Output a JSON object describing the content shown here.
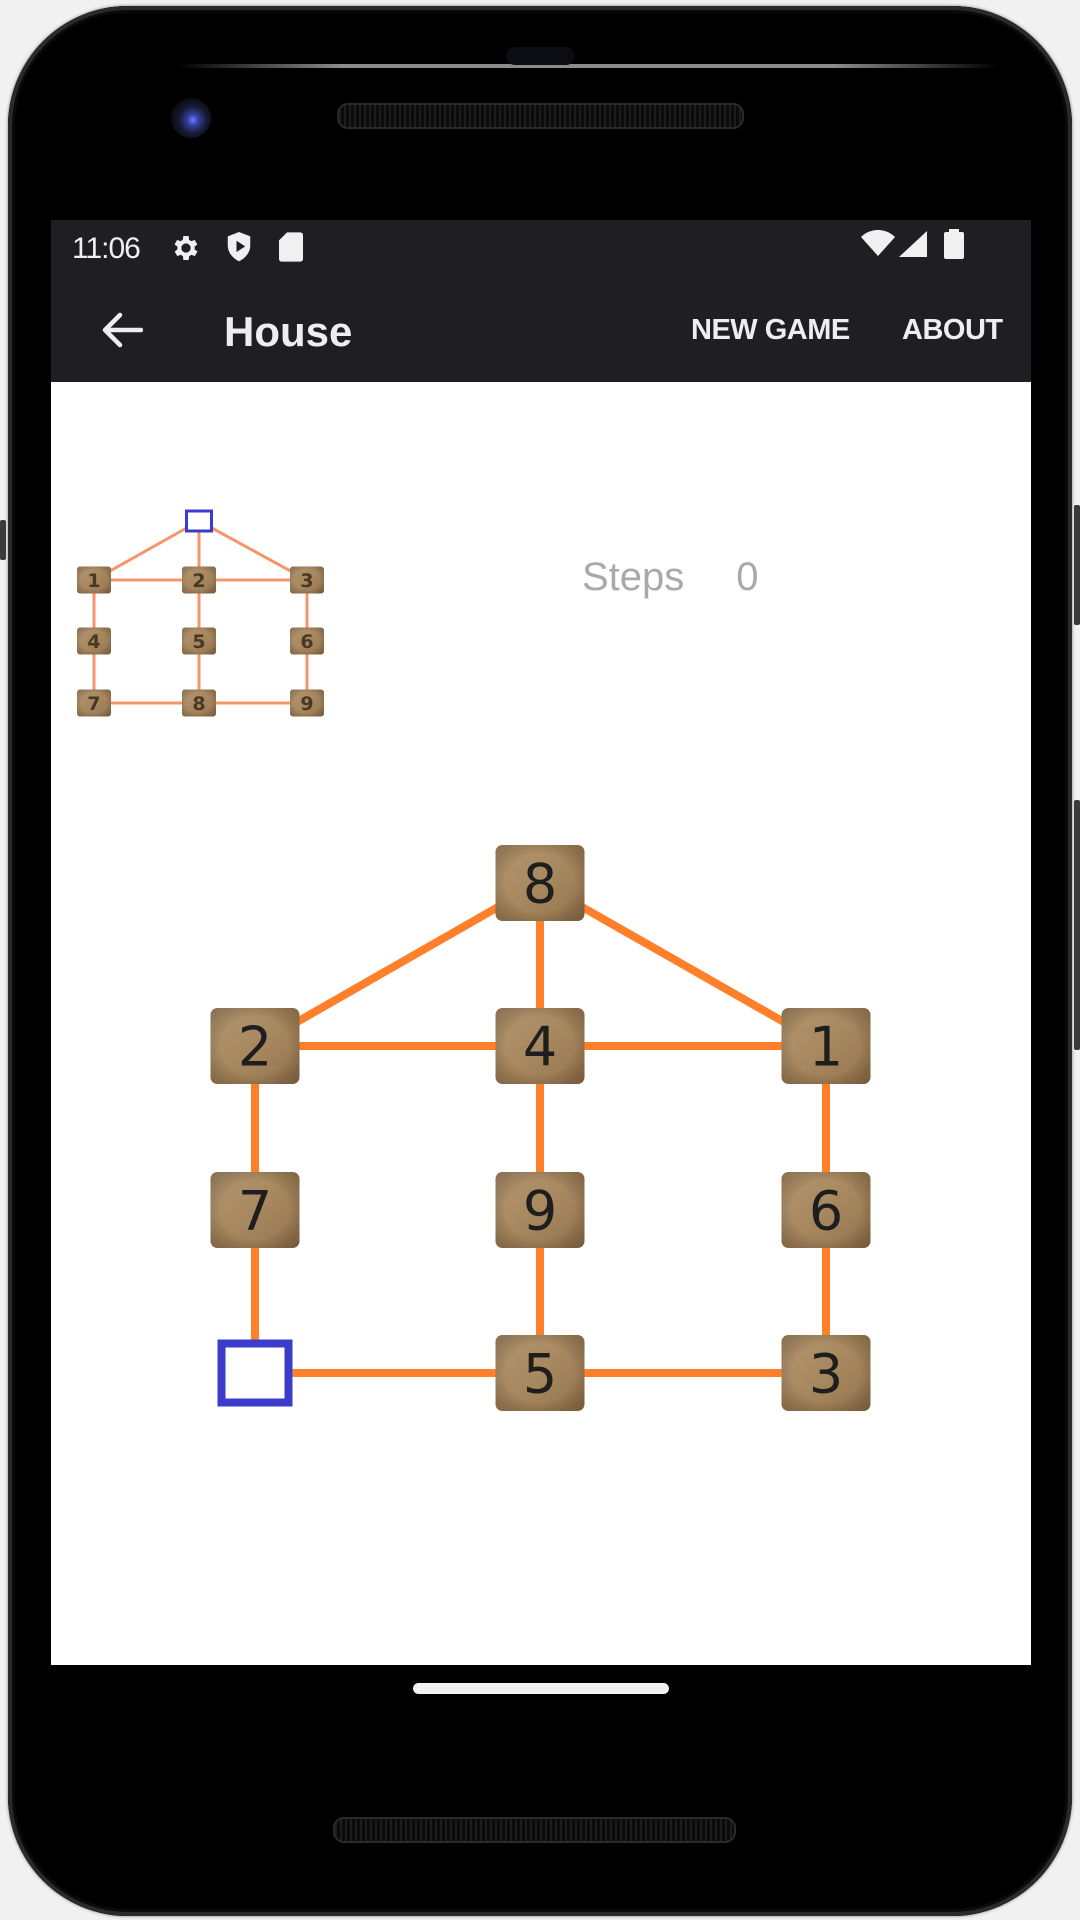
{
  "device": {
    "status_bar": {
      "time": "11:06",
      "left_icons": [
        "gear-icon",
        "shield-play-icon",
        "sd-card-icon"
      ],
      "right_icons": [
        "wifi-icon",
        "signal-icon",
        "battery-icon"
      ]
    }
  },
  "app_bar": {
    "back_icon": "arrow-left-icon",
    "title": "House",
    "actions": [
      {
        "label": "NEW GAME"
      },
      {
        "label": "ABOUT"
      }
    ]
  },
  "game": {
    "steps_label": "Steps",
    "steps_value": "0",
    "colors": {
      "edge": "#ff7f2a",
      "thumb_edge": "#f7956a",
      "empty_border": "#3c3ccc",
      "tile": "#a8885f",
      "tile_text": "#1e1e1e"
    },
    "nodes": [
      {
        "id": "top",
        "row": 0,
        "col": 1
      },
      {
        "id": "r1c0",
        "row": 1,
        "col": 0
      },
      {
        "id": "r1c1",
        "row": 1,
        "col": 1
      },
      {
        "id": "r1c2",
        "row": 1,
        "col": 2
      },
      {
        "id": "r2c0",
        "row": 2,
        "col": 0
      },
      {
        "id": "r2c1",
        "row": 2,
        "col": 1
      },
      {
        "id": "r2c2",
        "row": 2,
        "col": 2
      },
      {
        "id": "r3c0",
        "row": 3,
        "col": 0
      },
      {
        "id": "r3c1",
        "row": 3,
        "col": 1
      },
      {
        "id": "r3c2",
        "row": 3,
        "col": 2
      }
    ],
    "edges": [
      [
        "top",
        "r1c0"
      ],
      [
        "top",
        "r1c1"
      ],
      [
        "top",
        "r1c2"
      ],
      [
        "r1c0",
        "r1c1"
      ],
      [
        "r1c1",
        "r1c2"
      ],
      [
        "r1c0",
        "r2c0"
      ],
      [
        "r1c1",
        "r2c1"
      ],
      [
        "r1c2",
        "r2c2"
      ],
      [
        "r2c0",
        "r3c0"
      ],
      [
        "r2c1",
        "r3c1"
      ],
      [
        "r2c2",
        "r3c2"
      ],
      [
        "r3c0",
        "r3c1"
      ],
      [
        "r3c1",
        "r3c2"
      ]
    ],
    "goal_board": {
      "top": "",
      "r1c0": "1",
      "r1c1": "2",
      "r1c2": "3",
      "r2c0": "4",
      "r2c1": "5",
      "r2c2": "6",
      "r3c0": "7",
      "r3c1": "8",
      "r3c2": "9"
    },
    "current_board": {
      "top": "8",
      "r1c0": "2",
      "r1c1": "4",
      "r1c2": "1",
      "r2c0": "7",
      "r2c1": "9",
      "r2c2": "6",
      "r3c0": "",
      "r3c1": "5",
      "r3c2": "3"
    }
  }
}
